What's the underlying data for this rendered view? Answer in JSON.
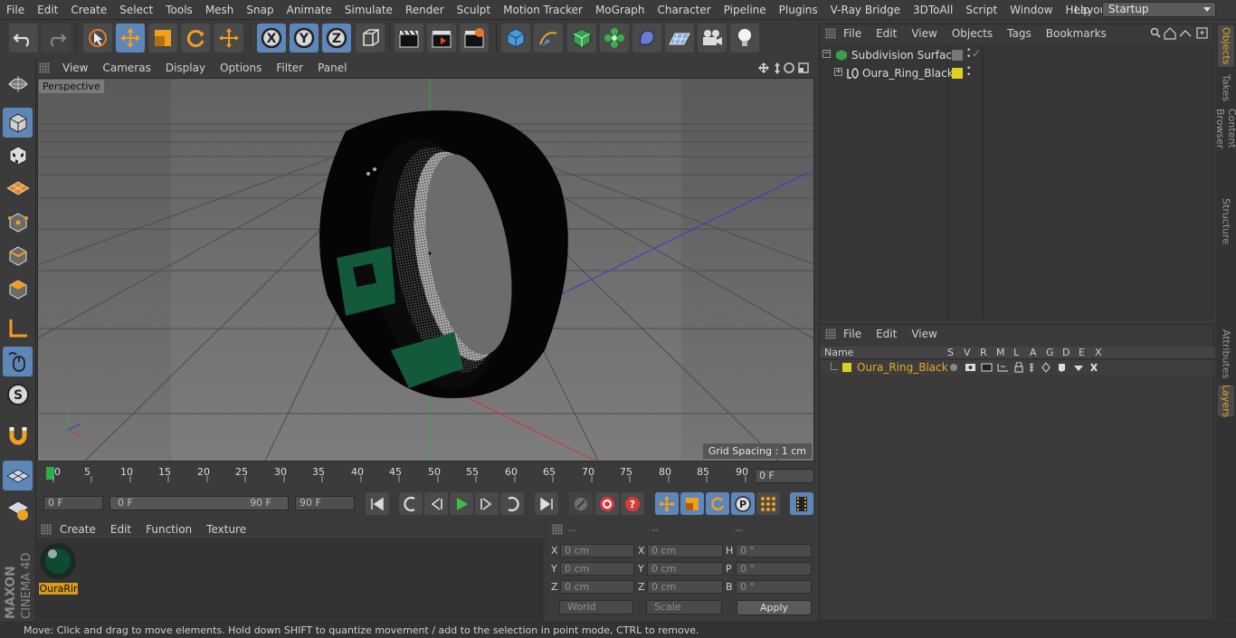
{
  "menubar": {
    "items": [
      "File",
      "Edit",
      "Create",
      "Select",
      "Tools",
      "Mesh",
      "Snap",
      "Animate",
      "Simulate",
      "Render",
      "Sculpt",
      "Motion Tracker",
      "MoGraph",
      "Character",
      "Pipeline",
      "Plugins",
      "V-Ray Bridge",
      "3DToAll",
      "Script",
      "Window",
      "Help"
    ],
    "layout_label": "Layout:",
    "layout_value": "Startup"
  },
  "viewport": {
    "menu": [
      "View",
      "Cameras",
      "Display",
      "Options",
      "Filter",
      "Panel"
    ],
    "name": "Perspective",
    "grid_spacing": "Grid Spacing : 1 cm"
  },
  "timeline": {
    "ticks": [
      "0",
      "5",
      "10",
      "15",
      "20",
      "25",
      "30",
      "35",
      "40",
      "45",
      "50",
      "55",
      "60",
      "65",
      "70",
      "75",
      "80",
      "85",
      "90"
    ],
    "current_frame": "0 F"
  },
  "anim": {
    "start_field": "0 F",
    "range_start": "0 F",
    "range_end": "90 F",
    "end_field": "90 F"
  },
  "materials": {
    "menu": [
      "Create",
      "Edit",
      "Function",
      "Texture"
    ],
    "items": [
      {
        "label": "OuraRir"
      }
    ]
  },
  "coordinates": {
    "headers": [
      "--",
      "--",
      "--"
    ],
    "rows": [
      {
        "l1": "X",
        "v1": "0 cm",
        "l2": "X",
        "v2": "0 cm",
        "l3": "H",
        "v3": "0 °"
      },
      {
        "l1": "Y",
        "v1": "0 cm",
        "l2": "Y",
        "v2": "0 cm",
        "l3": "P",
        "v3": "0 °"
      },
      {
        "l1": "Z",
        "v1": "0 cm",
        "l2": "Z",
        "v2": "0 cm",
        "l3": "B",
        "v3": "0 °"
      }
    ],
    "space": "World",
    "mode": "Scale",
    "apply": "Apply"
  },
  "status": "Move: Click and drag to move elements. Hold down SHIFT to quantize movement / add to the selection in point mode, CTRL to remove.",
  "objects": {
    "menu": [
      "File",
      "Edit",
      "View",
      "Objects",
      "Tags",
      "Bookmarks"
    ],
    "items": [
      {
        "name": "Subdivision Surface"
      },
      {
        "name": "Oura_Ring_Black"
      }
    ]
  },
  "layers": {
    "menu": [
      "File",
      "Edit",
      "View"
    ],
    "columns": [
      "Name",
      "S",
      "V",
      "R",
      "M",
      "L",
      "A",
      "G",
      "D",
      "E",
      "X"
    ],
    "items": [
      {
        "name": "Oura_Ring_Black"
      }
    ]
  },
  "right_tabs": [
    "Objects",
    "Takes",
    "Content Browser",
    "Structure",
    "Attributes",
    "Layers"
  ],
  "brand": {
    "maxon": "MAXON",
    "product": "CINEMA 4D"
  },
  "colors": {
    "accent": "#5d87b8",
    "highlight": "#e6a825",
    "layer_color": "#d9d21e"
  }
}
